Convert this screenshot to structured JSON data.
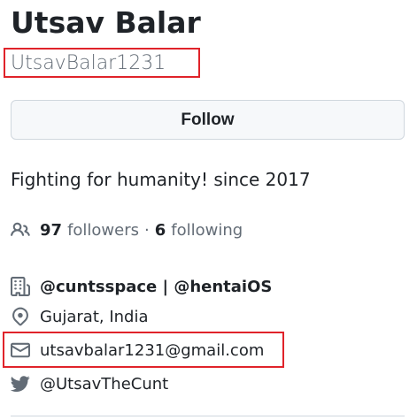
{
  "profile": {
    "full_name": "Utsav Balar",
    "username": "UtsavBalar1231",
    "follow_label": "Follow",
    "bio": "Fighting for humanity! since 2017"
  },
  "stats": {
    "followers_count": "97",
    "followers_label": "followers",
    "separator": "·",
    "following_count": "6",
    "following_label": "following"
  },
  "details": {
    "organizations": "@cuntsspace | @hentaiOS",
    "location": "Gujarat, India",
    "email": "utsavbalar1231@gmail.com",
    "twitter": "@UtsavTheCunt"
  },
  "colors": {
    "highlight_box": "#e0232a",
    "muted_text": "#636c76",
    "primary_text": "#1f2328",
    "button_bg": "#f6f8fa"
  },
  "icons": {
    "people": "people-icon",
    "organization": "organization-icon",
    "location": "location-pin-icon",
    "mail": "mail-icon",
    "twitter": "twitter-bird-icon"
  }
}
